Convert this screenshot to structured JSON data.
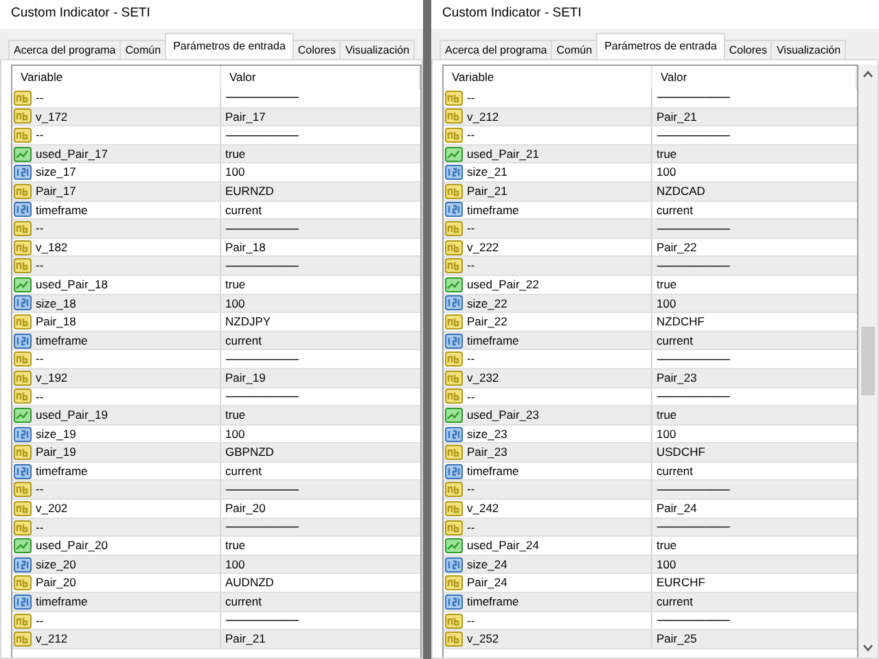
{
  "windows": [
    {
      "title": "Custom Indicator - SETI",
      "tabs": [
        {
          "label": "Acerca del programa",
          "selected": false
        },
        {
          "label": "Común",
          "selected": false
        },
        {
          "label": "Parámetros de entrada",
          "selected": true
        },
        {
          "label": "Colores",
          "selected": false
        },
        {
          "label": "Visualización",
          "selected": false
        }
      ],
      "columns": [
        "Variable",
        "Valor"
      ],
      "scrollbar": false,
      "rows": [
        {
          "kind": "string",
          "variable": "--",
          "value": "------------------------------------"
        },
        {
          "kind": "string",
          "variable": "v_172",
          "value": "Pair_17"
        },
        {
          "kind": "string",
          "variable": "--",
          "value": "------------------------------------"
        },
        {
          "kind": "bool",
          "variable": "used_Pair_17",
          "value": "true"
        },
        {
          "kind": "int",
          "variable": "size_17",
          "value": "100"
        },
        {
          "kind": "string",
          "variable": "Pair_17",
          "value": "EURNZD"
        },
        {
          "kind": "int",
          "variable": "timeframe",
          "value": "current"
        },
        {
          "kind": "string",
          "variable": "--",
          "value": "------------------------------------"
        },
        {
          "kind": "string",
          "variable": "v_182",
          "value": "Pair_18"
        },
        {
          "kind": "string",
          "variable": "--",
          "value": "------------------------------------"
        },
        {
          "kind": "bool",
          "variable": "used_Pair_18",
          "value": "true"
        },
        {
          "kind": "int",
          "variable": "size_18",
          "value": "100"
        },
        {
          "kind": "string",
          "variable": "Pair_18",
          "value": "NZDJPY"
        },
        {
          "kind": "int",
          "variable": "timeframe",
          "value": "current"
        },
        {
          "kind": "string",
          "variable": "--",
          "value": "------------------------------------"
        },
        {
          "kind": "string",
          "variable": "v_192",
          "value": "Pair_19"
        },
        {
          "kind": "string",
          "variable": "--",
          "value": "------------------------------------"
        },
        {
          "kind": "bool",
          "variable": "used_Pair_19",
          "value": "true"
        },
        {
          "kind": "int",
          "variable": "size_19",
          "value": "100"
        },
        {
          "kind": "string",
          "variable": "Pair_19",
          "value": "GBPNZD"
        },
        {
          "kind": "int",
          "variable": "timeframe",
          "value": "current"
        },
        {
          "kind": "string",
          "variable": "--",
          "value": "------------------------------------"
        },
        {
          "kind": "string",
          "variable": "v_202",
          "value": "Pair_20"
        },
        {
          "kind": "string",
          "variable": "--",
          "value": "------------------------------------"
        },
        {
          "kind": "bool",
          "variable": "used_Pair_20",
          "value": "true"
        },
        {
          "kind": "int",
          "variable": "size_20",
          "value": "100"
        },
        {
          "kind": "string",
          "variable": "Pair_20",
          "value": "AUDNZD"
        },
        {
          "kind": "int",
          "variable": "timeframe",
          "value": "current"
        },
        {
          "kind": "string",
          "variable": "--",
          "value": "------------------------------------"
        },
        {
          "kind": "string",
          "variable": "v_212",
          "value": "Pair_21"
        }
      ]
    },
    {
      "title": "Custom Indicator - SETI",
      "tabs": [
        {
          "label": "Acerca del programa",
          "selected": false
        },
        {
          "label": "Común",
          "selected": false
        },
        {
          "label": "Parámetros de entrada",
          "selected": true
        },
        {
          "label": "Colores",
          "selected": false
        },
        {
          "label": "Visualización",
          "selected": false
        }
      ],
      "columns": [
        "Variable",
        "Valor"
      ],
      "scrollbar": true,
      "rows": [
        {
          "kind": "string",
          "variable": "--",
          "value": "------------------------------------"
        },
        {
          "kind": "string",
          "variable": "v_212",
          "value": "Pair_21"
        },
        {
          "kind": "string",
          "variable": "--",
          "value": "------------------------------------"
        },
        {
          "kind": "bool",
          "variable": "used_Pair_21",
          "value": "true"
        },
        {
          "kind": "int",
          "variable": "size_21",
          "value": "100"
        },
        {
          "kind": "string",
          "variable": "Pair_21",
          "value": "NZDCAD"
        },
        {
          "kind": "int",
          "variable": "timeframe",
          "value": "current"
        },
        {
          "kind": "string",
          "variable": "--",
          "value": "------------------------------------"
        },
        {
          "kind": "string",
          "variable": "v_222",
          "value": "Pair_22"
        },
        {
          "kind": "string",
          "variable": "--",
          "value": "------------------------------------"
        },
        {
          "kind": "bool",
          "variable": "used_Pair_22",
          "value": "true"
        },
        {
          "kind": "int",
          "variable": "size_22",
          "value": "100"
        },
        {
          "kind": "string",
          "variable": "Pair_22",
          "value": "NZDCHF"
        },
        {
          "kind": "int",
          "variable": "timeframe",
          "value": "current"
        },
        {
          "kind": "string",
          "variable": "--",
          "value": "------------------------------------"
        },
        {
          "kind": "string",
          "variable": "v_232",
          "value": "Pair_23"
        },
        {
          "kind": "string",
          "variable": "--",
          "value": "------------------------------------"
        },
        {
          "kind": "bool",
          "variable": "used_Pair_23",
          "value": "true"
        },
        {
          "kind": "int",
          "variable": "size_23",
          "value": "100"
        },
        {
          "kind": "string",
          "variable": "Pair_23",
          "value": "USDCHF"
        },
        {
          "kind": "int",
          "variable": "timeframe",
          "value": "current"
        },
        {
          "kind": "string",
          "variable": "--",
          "value": "------------------------------------"
        },
        {
          "kind": "string",
          "variable": "v_242",
          "value": "Pair_24"
        },
        {
          "kind": "string",
          "variable": "--",
          "value": "------------------------------------"
        },
        {
          "kind": "bool",
          "variable": "used_Pair_24",
          "value": "true"
        },
        {
          "kind": "int",
          "variable": "size_24",
          "value": "100"
        },
        {
          "kind": "string",
          "variable": "Pair_24",
          "value": "EURCHF"
        },
        {
          "kind": "int",
          "variable": "timeframe",
          "value": "current"
        },
        {
          "kind": "string",
          "variable": "--",
          "value": "------------------------------------"
        },
        {
          "kind": "string",
          "variable": "v_252",
          "value": "Pair_25"
        }
      ]
    }
  ]
}
